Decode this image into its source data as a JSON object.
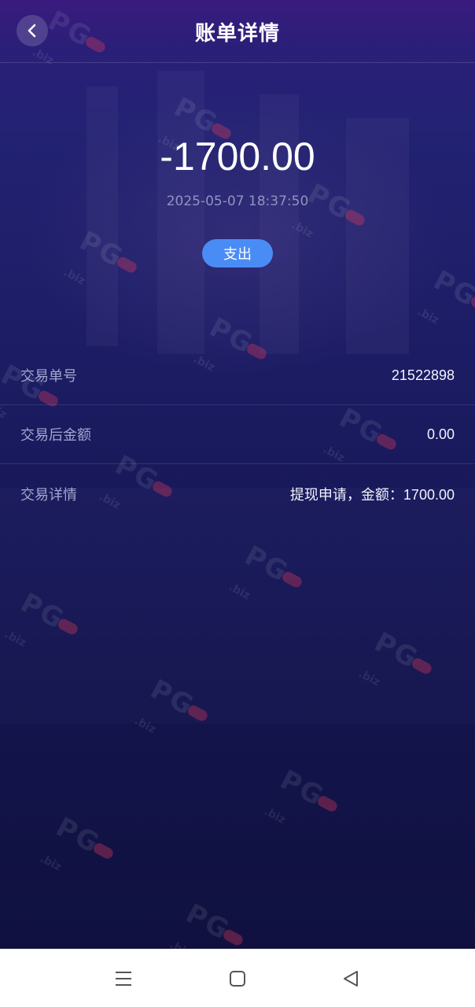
{
  "header": {
    "title": "账单详情",
    "back_icon": "chevron-left-icon"
  },
  "summary": {
    "amount": "-1700.00",
    "datetime": "2025-05-07 18:37:50",
    "type_label": "支出",
    "type_color": "#4a8cf5"
  },
  "details": [
    {
      "label": "交易单号",
      "value": "21522898"
    },
    {
      "label": "交易后金额",
      "value": "0.00"
    },
    {
      "label": "交易详情",
      "value": "提现申请，金额：1700.00"
    }
  ],
  "watermark": {
    "text": "PG",
    "suffix": ".biz"
  },
  "navbar": {
    "menu_icon": "menu-icon",
    "home_icon": "home-square-icon",
    "back_icon": "back-triangle-icon"
  },
  "colors": {
    "background": "#11124a",
    "accent": "#4a8cf5",
    "muted_text": "#8f93c2"
  }
}
